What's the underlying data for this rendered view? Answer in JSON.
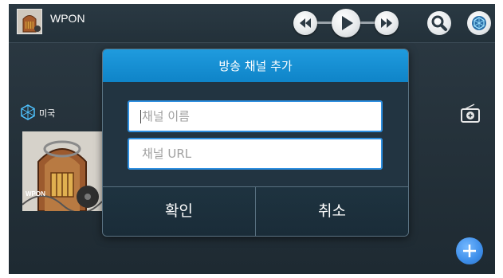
{
  "app": {
    "title": "WPON"
  },
  "toolbar": {
    "icons": [
      "rewind-icon",
      "play-icon",
      "fast-forward-icon",
      "search-icon",
      "globe-icon"
    ]
  },
  "sidebar": {
    "country_label": "미국",
    "thumbnail_caption": "WPON"
  },
  "dialog": {
    "title": "방송 채널 추가",
    "name_placeholder": "채널 이름",
    "url_placeholder": "채널 URL",
    "ok_label": "확인",
    "cancel_label": "취소"
  },
  "colors": {
    "dialog_header": "#1a93d6",
    "background": "#26333c",
    "fab": "#3d8eea"
  }
}
